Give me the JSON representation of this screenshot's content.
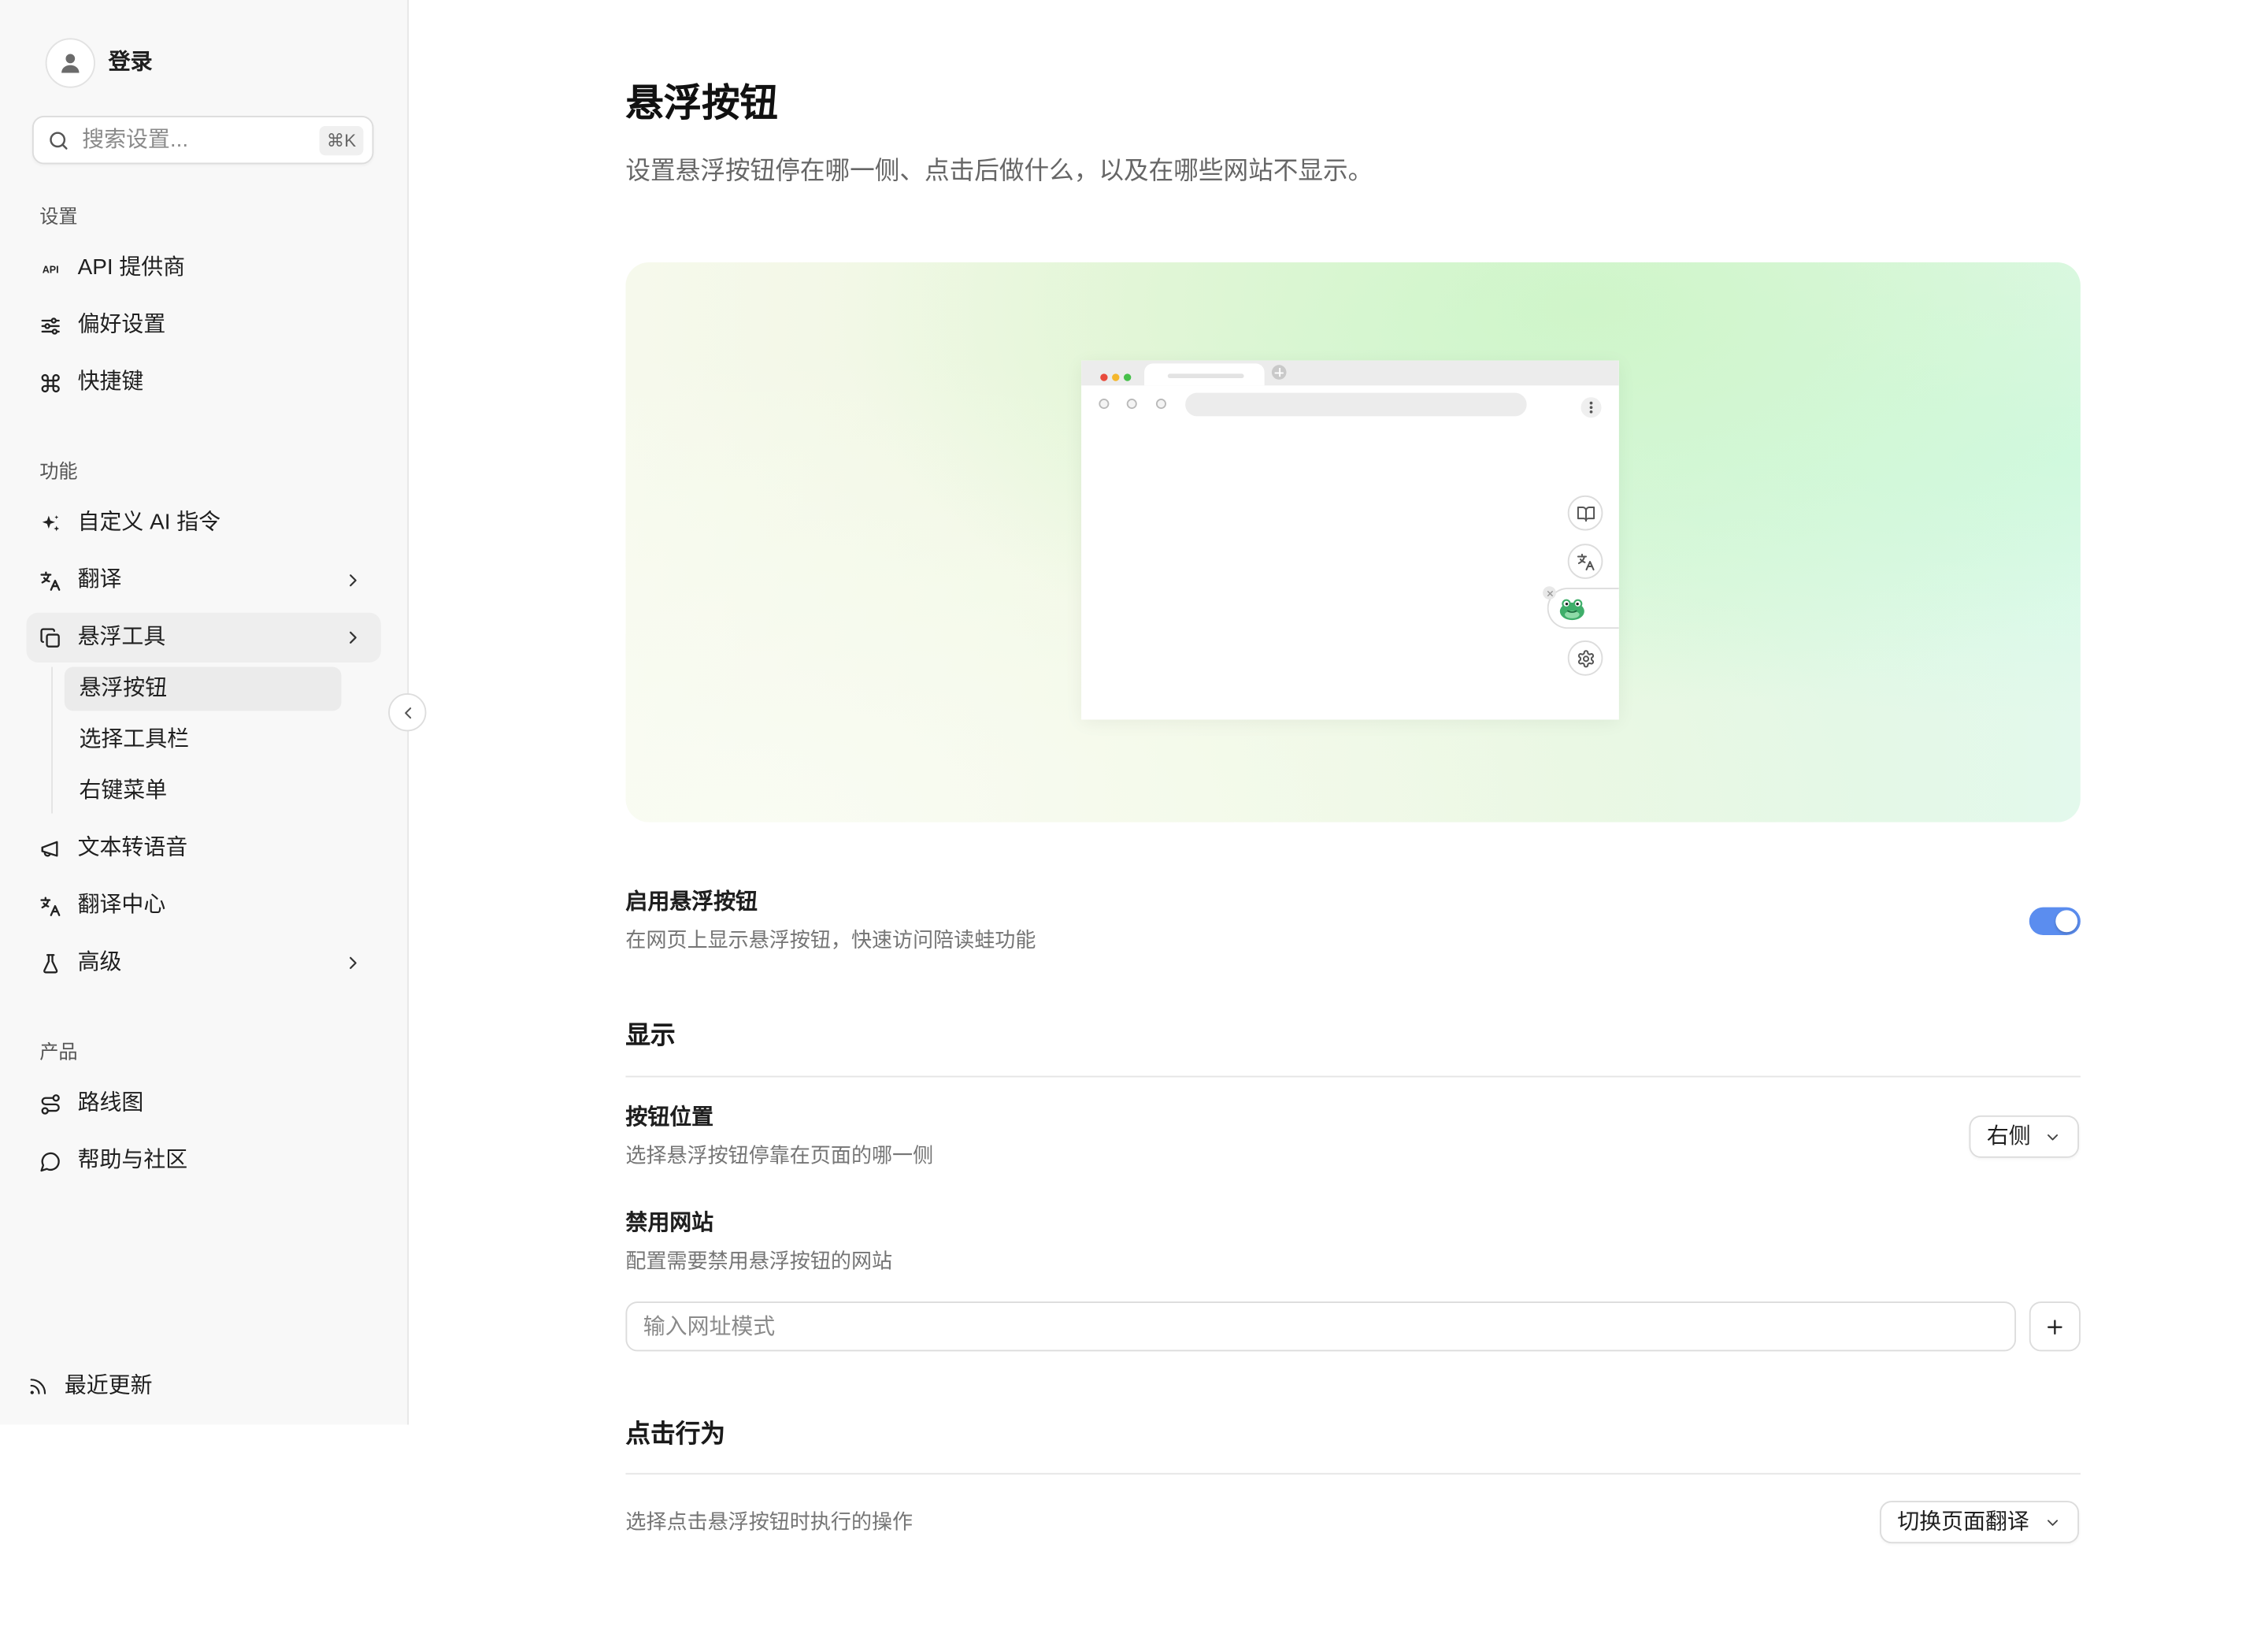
{
  "sidebar": {
    "user": {
      "login_label": "登录",
      "icon": "user-icon"
    },
    "search": {
      "placeholder": "搜索设置...",
      "shortcut": "⌘K",
      "icon": "search-icon"
    },
    "sections": [
      {
        "label": "设置",
        "items": [
          {
            "label": "API 提供商",
            "icon": "api-icon",
            "icon_text": "API"
          },
          {
            "label": "偏好设置",
            "icon": "sliders-icon"
          },
          {
            "label": "快捷键",
            "icon": "command-icon"
          }
        ]
      },
      {
        "label": "功能",
        "items": [
          {
            "label": "自定义 AI 指令",
            "icon": "sparkles-icon"
          },
          {
            "label": "翻译",
            "icon": "translate-icon",
            "has_submenu": true
          },
          {
            "label": "悬浮工具",
            "icon": "floating-tools-icon",
            "has_submenu": true,
            "expanded": true,
            "children": [
              {
                "label": "悬浮按钮",
                "active": true
              },
              {
                "label": "选择工具栏"
              },
              {
                "label": "右键菜单"
              }
            ]
          },
          {
            "label": "文本转语音",
            "icon": "megaphone-icon"
          },
          {
            "label": "翻译中心",
            "icon": "translation-center-icon"
          },
          {
            "label": "高级",
            "icon": "flask-icon",
            "has_submenu": true
          }
        ]
      },
      {
        "label": "产品",
        "items": [
          {
            "label": "路线图",
            "icon": "route-icon"
          },
          {
            "label": "帮助与社区",
            "icon": "message-circle-icon"
          }
        ]
      }
    ],
    "footer": {
      "label": "最近更新",
      "icon": "rss-icon"
    },
    "collapse_icon": "chevron-left-icon"
  },
  "page": {
    "title": "悬浮按钮",
    "subtitle": "设置悬浮按钮停在哪一侧、点击后做什么，以及在哪些网站不显示。"
  },
  "preview": {
    "floating_buttons": [
      {
        "icon": "book-open-icon"
      },
      {
        "icon": "translate-icon"
      },
      {
        "icon": "frog-logo-icon"
      },
      {
        "icon": "settings-icon"
      }
    ]
  },
  "settings": {
    "enable": {
      "title": "启用悬浮按钮",
      "description": "在网页上显示悬浮按钮，快速访问陪读蛙功能",
      "enabled": true
    },
    "display": {
      "heading": "显示",
      "position": {
        "title": "按钮位置",
        "description": "选择悬浮按钮停靠在页面的哪一侧",
        "value": "右侧"
      },
      "disabled_sites": {
        "title": "禁用网站",
        "description": "配置需要禁用悬浮按钮的网站",
        "placeholder": "输入网址模式",
        "add_icon": "plus-icon"
      }
    },
    "click_behavior": {
      "heading": "点击行为",
      "description": "选择点击悬浮按钮时执行的操作",
      "value": "切换页面翻译"
    }
  },
  "colors": {
    "accent": "#5b8def",
    "sidebar_bg": "#f8f8f8",
    "active_item_bg": "#eeeeee"
  }
}
